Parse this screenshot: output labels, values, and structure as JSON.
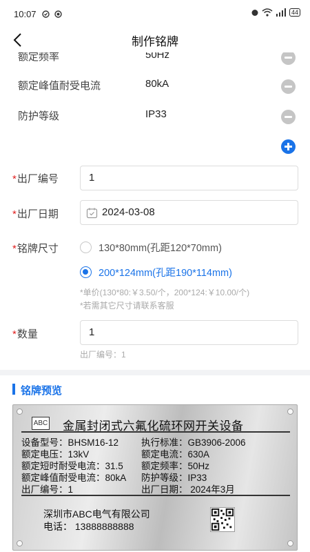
{
  "status": {
    "time": "10:07",
    "battery": "44"
  },
  "nav": {
    "title": "制作铭牌"
  },
  "specs": [
    {
      "label": "额定频率",
      "value": "50Hz"
    },
    {
      "label": "额定峰值耐受电流",
      "value": "80kA"
    },
    {
      "label": "防护等级",
      "value": "IP33"
    }
  ],
  "form": {
    "required_mark": "*",
    "serial_label": "出厂编号",
    "serial_value": "1",
    "date_label": "出厂日期",
    "date_value": "2024-03-08",
    "size_label": "铭牌尺寸",
    "size_options": [
      {
        "label": "130*80mm(孔距120*70mm)",
        "selected": false
      },
      {
        "label": "200*124mm(孔距190*114mm)",
        "selected": true
      }
    ],
    "price_note": "*单价(130*80:￥3.50/个，200*124:￥10.00/个)",
    "size_note": "*若需其它尺寸请联系客服",
    "qty_label": "数量",
    "qty_value": "1",
    "qty_hint": "出厂编号：1"
  },
  "preview": {
    "title": "铭牌预览",
    "plate": {
      "logo": "ABC",
      "title": "金属封闭式六氟化硫环网开关设备",
      "left_lines": [
        "设备型号：BHSM16-12",
        "额定电压：13kV",
        "额定短时耐受电流：31.5",
        "额定峰值耐受电流：80kA",
        "出厂编号：1"
      ],
      "right_lines": [
        "执行标准：GB3906-2006",
        "额定电流：630A",
        "额定频率：50Hz",
        "防护等级：IP33",
        "出厂日期：   2024年3月"
      ],
      "company": "深圳市ABC电气有限公司",
      "phone": "电话：  13888888888"
    }
  },
  "colors": {
    "accent": "#1a73e8",
    "required": "#e02020"
  }
}
